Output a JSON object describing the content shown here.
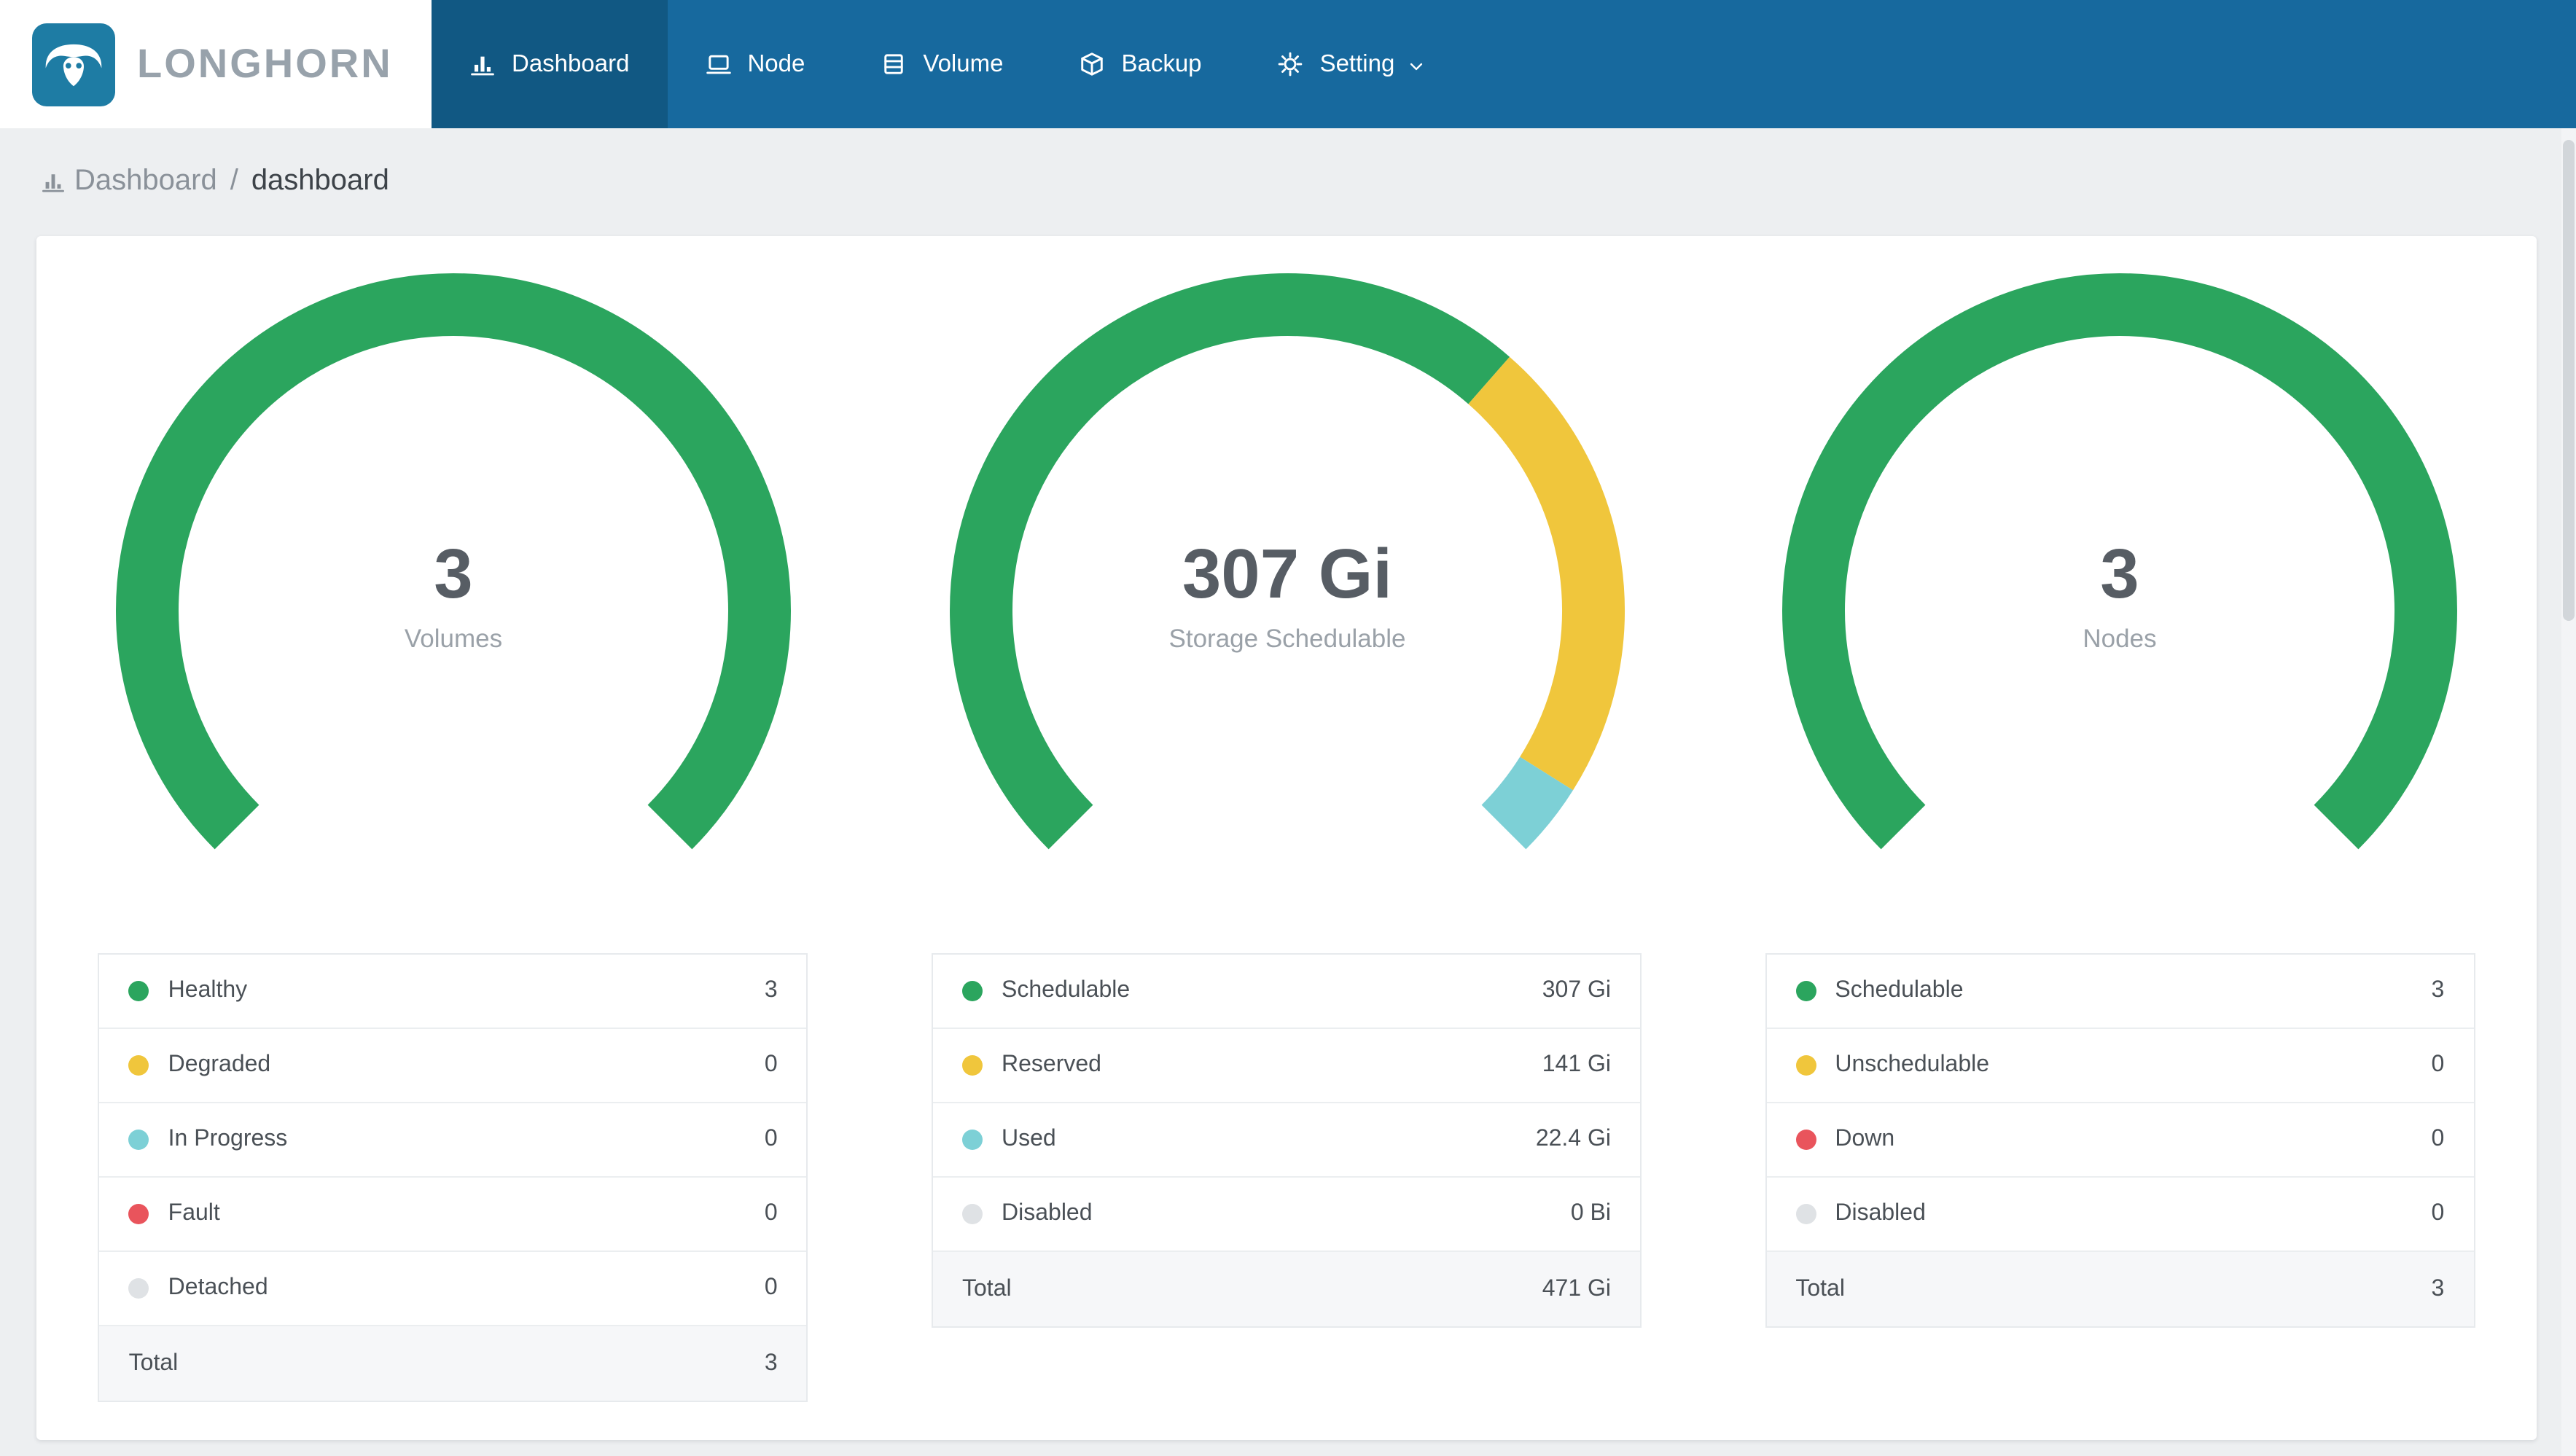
{
  "app": {
    "logo_text": "LONGHORN",
    "nav_items": [
      {
        "label": "Dashboard",
        "icon": "bar-chart-icon",
        "active": true,
        "dropdown": false
      },
      {
        "label": "Node",
        "icon": "laptop-icon",
        "active": false,
        "dropdown": false
      },
      {
        "label": "Volume",
        "icon": "database-icon",
        "active": false,
        "dropdown": false
      },
      {
        "label": "Backup",
        "icon": "cube-icon",
        "active": false,
        "dropdown": false
      },
      {
        "label": "Setting",
        "icon": "gear-icon",
        "active": false,
        "dropdown": true
      }
    ]
  },
  "breadcrumb": {
    "section": "Dashboard",
    "separator": "/",
    "page": "dashboard"
  },
  "colors": {
    "navbar": "#17699E",
    "navbar_active": "#115883",
    "logo_square": "#1E7CA4",
    "green": "#2BA55E",
    "yellow": "#F0C63C",
    "teal": "#7DD0D6",
    "red": "#E9545C",
    "gray": "#DFE2E5"
  },
  "chart_data": [
    {
      "type": "gauge-donut",
      "center_value": "3",
      "center_label": "Volumes",
      "start_angle": 225,
      "sweep": 270,
      "segments": [
        {
          "label": "Healthy",
          "value": 3,
          "display": "3",
          "color_key": "green"
        },
        {
          "label": "Degraded",
          "value": 0,
          "display": "0",
          "color_key": "yellow"
        },
        {
          "label": "In Progress",
          "value": 0,
          "display": "0",
          "color_key": "teal"
        },
        {
          "label": "Fault",
          "value": 0,
          "display": "0",
          "color_key": "red"
        },
        {
          "label": "Detached",
          "value": 0,
          "display": "0",
          "color_key": "gray"
        }
      ],
      "total_label": "Total",
      "total_display": "3"
    },
    {
      "type": "gauge-donut",
      "center_value": "307 Gi",
      "center_label": "Storage Schedulable",
      "start_angle": 225,
      "sweep": 270,
      "segments": [
        {
          "label": "Schedulable",
          "value": 307,
          "display": "307 Gi",
          "color_key": "green"
        },
        {
          "label": "Reserved",
          "value": 141,
          "display": "141 Gi",
          "color_key": "yellow"
        },
        {
          "label": "Used",
          "value": 22.4,
          "display": "22.4 Gi",
          "color_key": "teal"
        },
        {
          "label": "Disabled",
          "value": 0,
          "display": "0 Bi",
          "color_key": "gray"
        }
      ],
      "total_label": "Total",
      "total_display": "471 Gi"
    },
    {
      "type": "gauge-donut",
      "center_value": "3",
      "center_label": "Nodes",
      "start_angle": 225,
      "sweep": 270,
      "segments": [
        {
          "label": "Schedulable",
          "value": 3,
          "display": "3",
          "color_key": "green"
        },
        {
          "label": "Unschedulable",
          "value": 0,
          "display": "0",
          "color_key": "yellow"
        },
        {
          "label": "Down",
          "value": 0,
          "display": "0",
          "color_key": "red"
        },
        {
          "label": "Disabled",
          "value": 0,
          "display": "0",
          "color_key": "gray"
        }
      ],
      "total_label": "Total",
      "total_display": "3"
    }
  ]
}
